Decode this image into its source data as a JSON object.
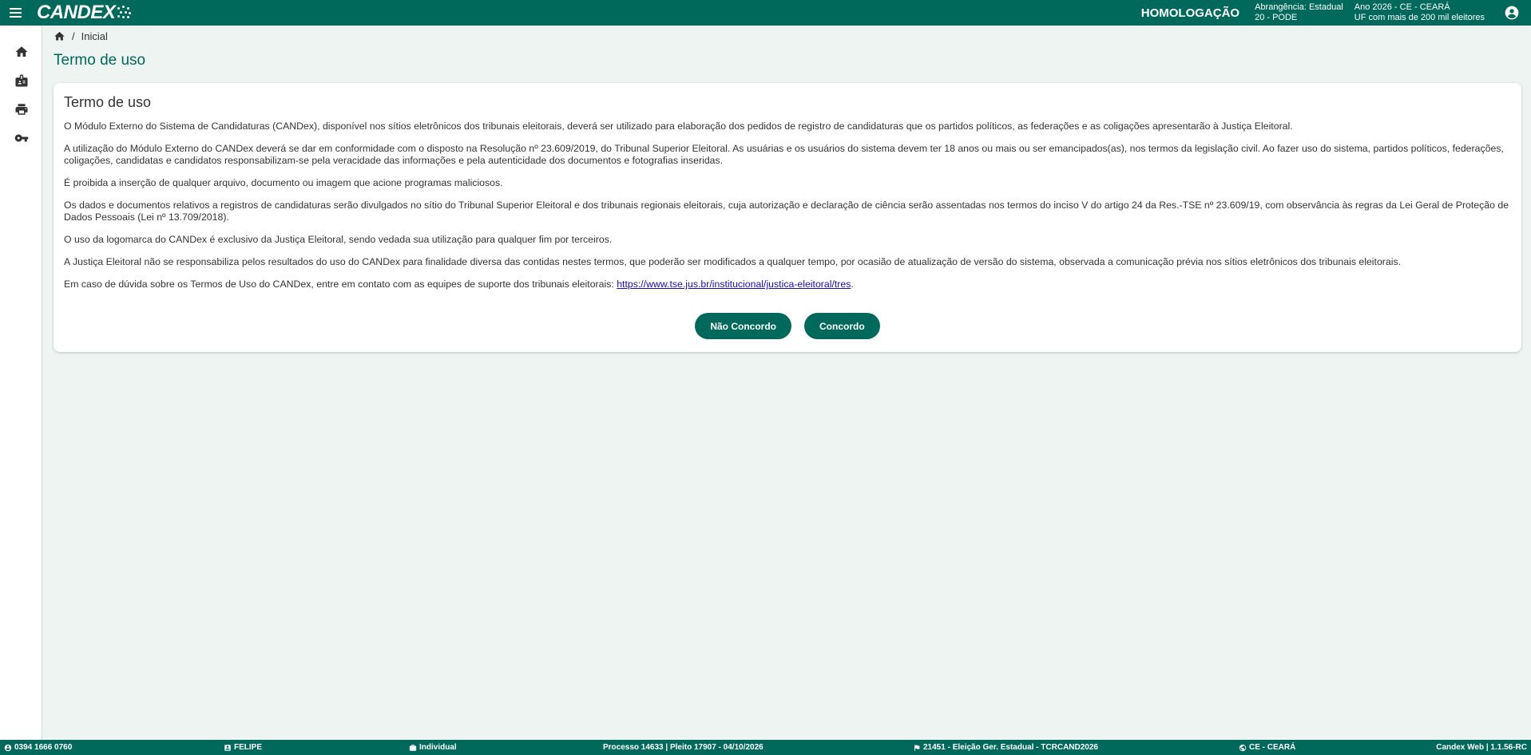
{
  "header": {
    "logo_text": "CANDEX",
    "environment": "HOMOLOGAÇÃO",
    "scope_line1": "Abrangência: Estadual",
    "scope_line2": "20 - PODE",
    "year_line1": "Ano 2026 - CE - CEARÁ",
    "year_line2": "UF com mais de 200 mil eleitores"
  },
  "sidebar": {
    "items": [
      {
        "icon": "home-icon"
      },
      {
        "icon": "badge-icon"
      },
      {
        "icon": "print-icon"
      },
      {
        "icon": "key-icon"
      }
    ]
  },
  "breadcrumb": {
    "current": "Inicial",
    "separator": "/"
  },
  "page_title": "Termo de uso",
  "card": {
    "title": "Termo de uso",
    "paragraphs": [
      "O Módulo Externo do Sistema de Candidaturas (CANDex), disponível nos sítios eletrônicos dos tribunais eleitorais, deverá ser utilizado para elaboração dos pedidos de registro de candidaturas que os partidos políticos, as federações e as coligações apresentarão à Justiça Eleitoral.",
      "A utilização do Módulo Externo do CANDex deverá se dar em conformidade com o disposto na Resolução nº 23.609/2019, do Tribunal Superior Eleitoral. As usuárias e os usuários do sistema devem ter 18 anos ou mais ou ser emancipados(as), nos termos da legislação civil. Ao fazer uso do sistema, partidos políticos, federações, coligações, candidatas e candidatos responsabilizam-se pela veracidade das informações e pela autenticidade dos documentos e fotografias inseridas.",
      "É proibida a inserção de qualquer arquivo, documento ou imagem que acione programas maliciosos.",
      "Os dados e documentos relativos a registros de candidaturas serão divulgados no sítio do Tribunal Superior Eleitoral e dos tribunais regionais eleitorais, cuja autorização e declaração de ciência serão assentadas nos termos do inciso V do artigo 24 da Res.-TSE nº 23.609/19, com observância às regras da Lei Geral de Proteção de Dados Pessoais (Lei nº 13.709/2018).",
      "O uso da logomarca do CANDex é exclusivo da Justiça Eleitoral, sendo vedada sua utilização para qualquer fim por terceiros.",
      "A Justiça Eleitoral não se responsabiliza pelos resultados do uso do CANDex para finalidade diversa das contidas nestes termos, que poderão ser modificados a qualquer tempo, por ocasião de atualização de versão do sistema, observada a comunicação prévia nos sítios eletrônicos dos tribunais eleitorais."
    ],
    "contact_prefix": "Em caso de dúvida sobre os Termos de Uso do CANDex, entre em contato com as equipes de suporte dos tribunais eleitorais: ",
    "contact_link": "https://www.tse.jus.br/institucional/justica-eleitoral/tres",
    "contact_suffix": ".",
    "decline_label": "Não Concordo",
    "accept_label": "Concordo"
  },
  "footer": {
    "cpf": "0394 1666 0760",
    "user": "FELIPE",
    "type": "Individual",
    "process": "Processo 14633 | Pleito 17907 - 04/10/2026",
    "election": "21451 - Eleição Ger. Estadual - TCRCAND2026",
    "uf": "CE - CEARÁ",
    "version": "Candex Web | 1.1.56-RC"
  },
  "colors": {
    "primary": "#00695c",
    "background": "#eef4f2"
  }
}
